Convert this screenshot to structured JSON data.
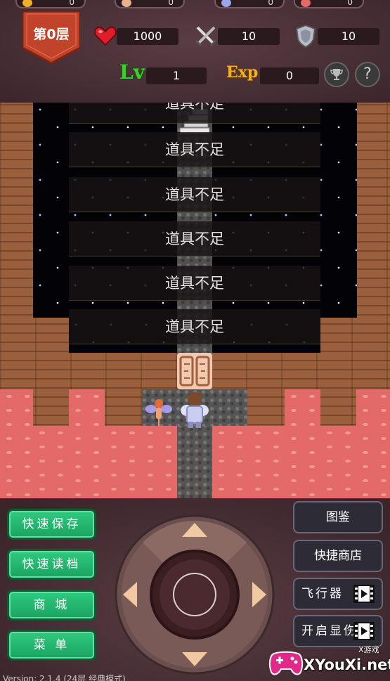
{
  "hud": {
    "floor_label": "第0层",
    "resources": [
      {
        "icon": "gold-coin-icon",
        "value": "0",
        "color": "#f0b02a"
      },
      {
        "icon": "yellow-key-icon",
        "value": "0",
        "color": "#e8b28a"
      },
      {
        "icon": "blue-key-icon",
        "value": "0",
        "color": "#9aa6e8"
      },
      {
        "icon": "red-key-icon",
        "value": "0",
        "color": "#e46a6a"
      }
    ],
    "hp": "1000",
    "attack": "10",
    "defense": "10",
    "lv_label": "Lv",
    "lv": "1",
    "exp_label": "Exp",
    "exp": "0",
    "trophy_icon": "trophy-icon",
    "help_symbol": "?"
  },
  "map": {
    "messages": [
      "道具不足",
      "道具不足",
      "道具不足",
      "道具不足",
      "道具不足",
      "道具不足"
    ],
    "colors": {
      "lava": "#e46a6a",
      "wall": "#9a5f3c",
      "space": "#020207"
    }
  },
  "controls": {
    "left_buttons": [
      "快速保存",
      "快速读档",
      "商 城",
      "菜 单"
    ],
    "right_buttons": [
      {
        "label": "图鉴",
        "video": false
      },
      {
        "label": "快捷商店",
        "video": false
      },
      {
        "label": "飞行器",
        "video": true
      },
      {
        "label": "开启显伤",
        "video": true
      }
    ],
    "version": "Version: 2.1.4 (24层 经典模式)",
    "watermark_big": "XYouXi.net",
    "watermark_small": "X游戏"
  }
}
